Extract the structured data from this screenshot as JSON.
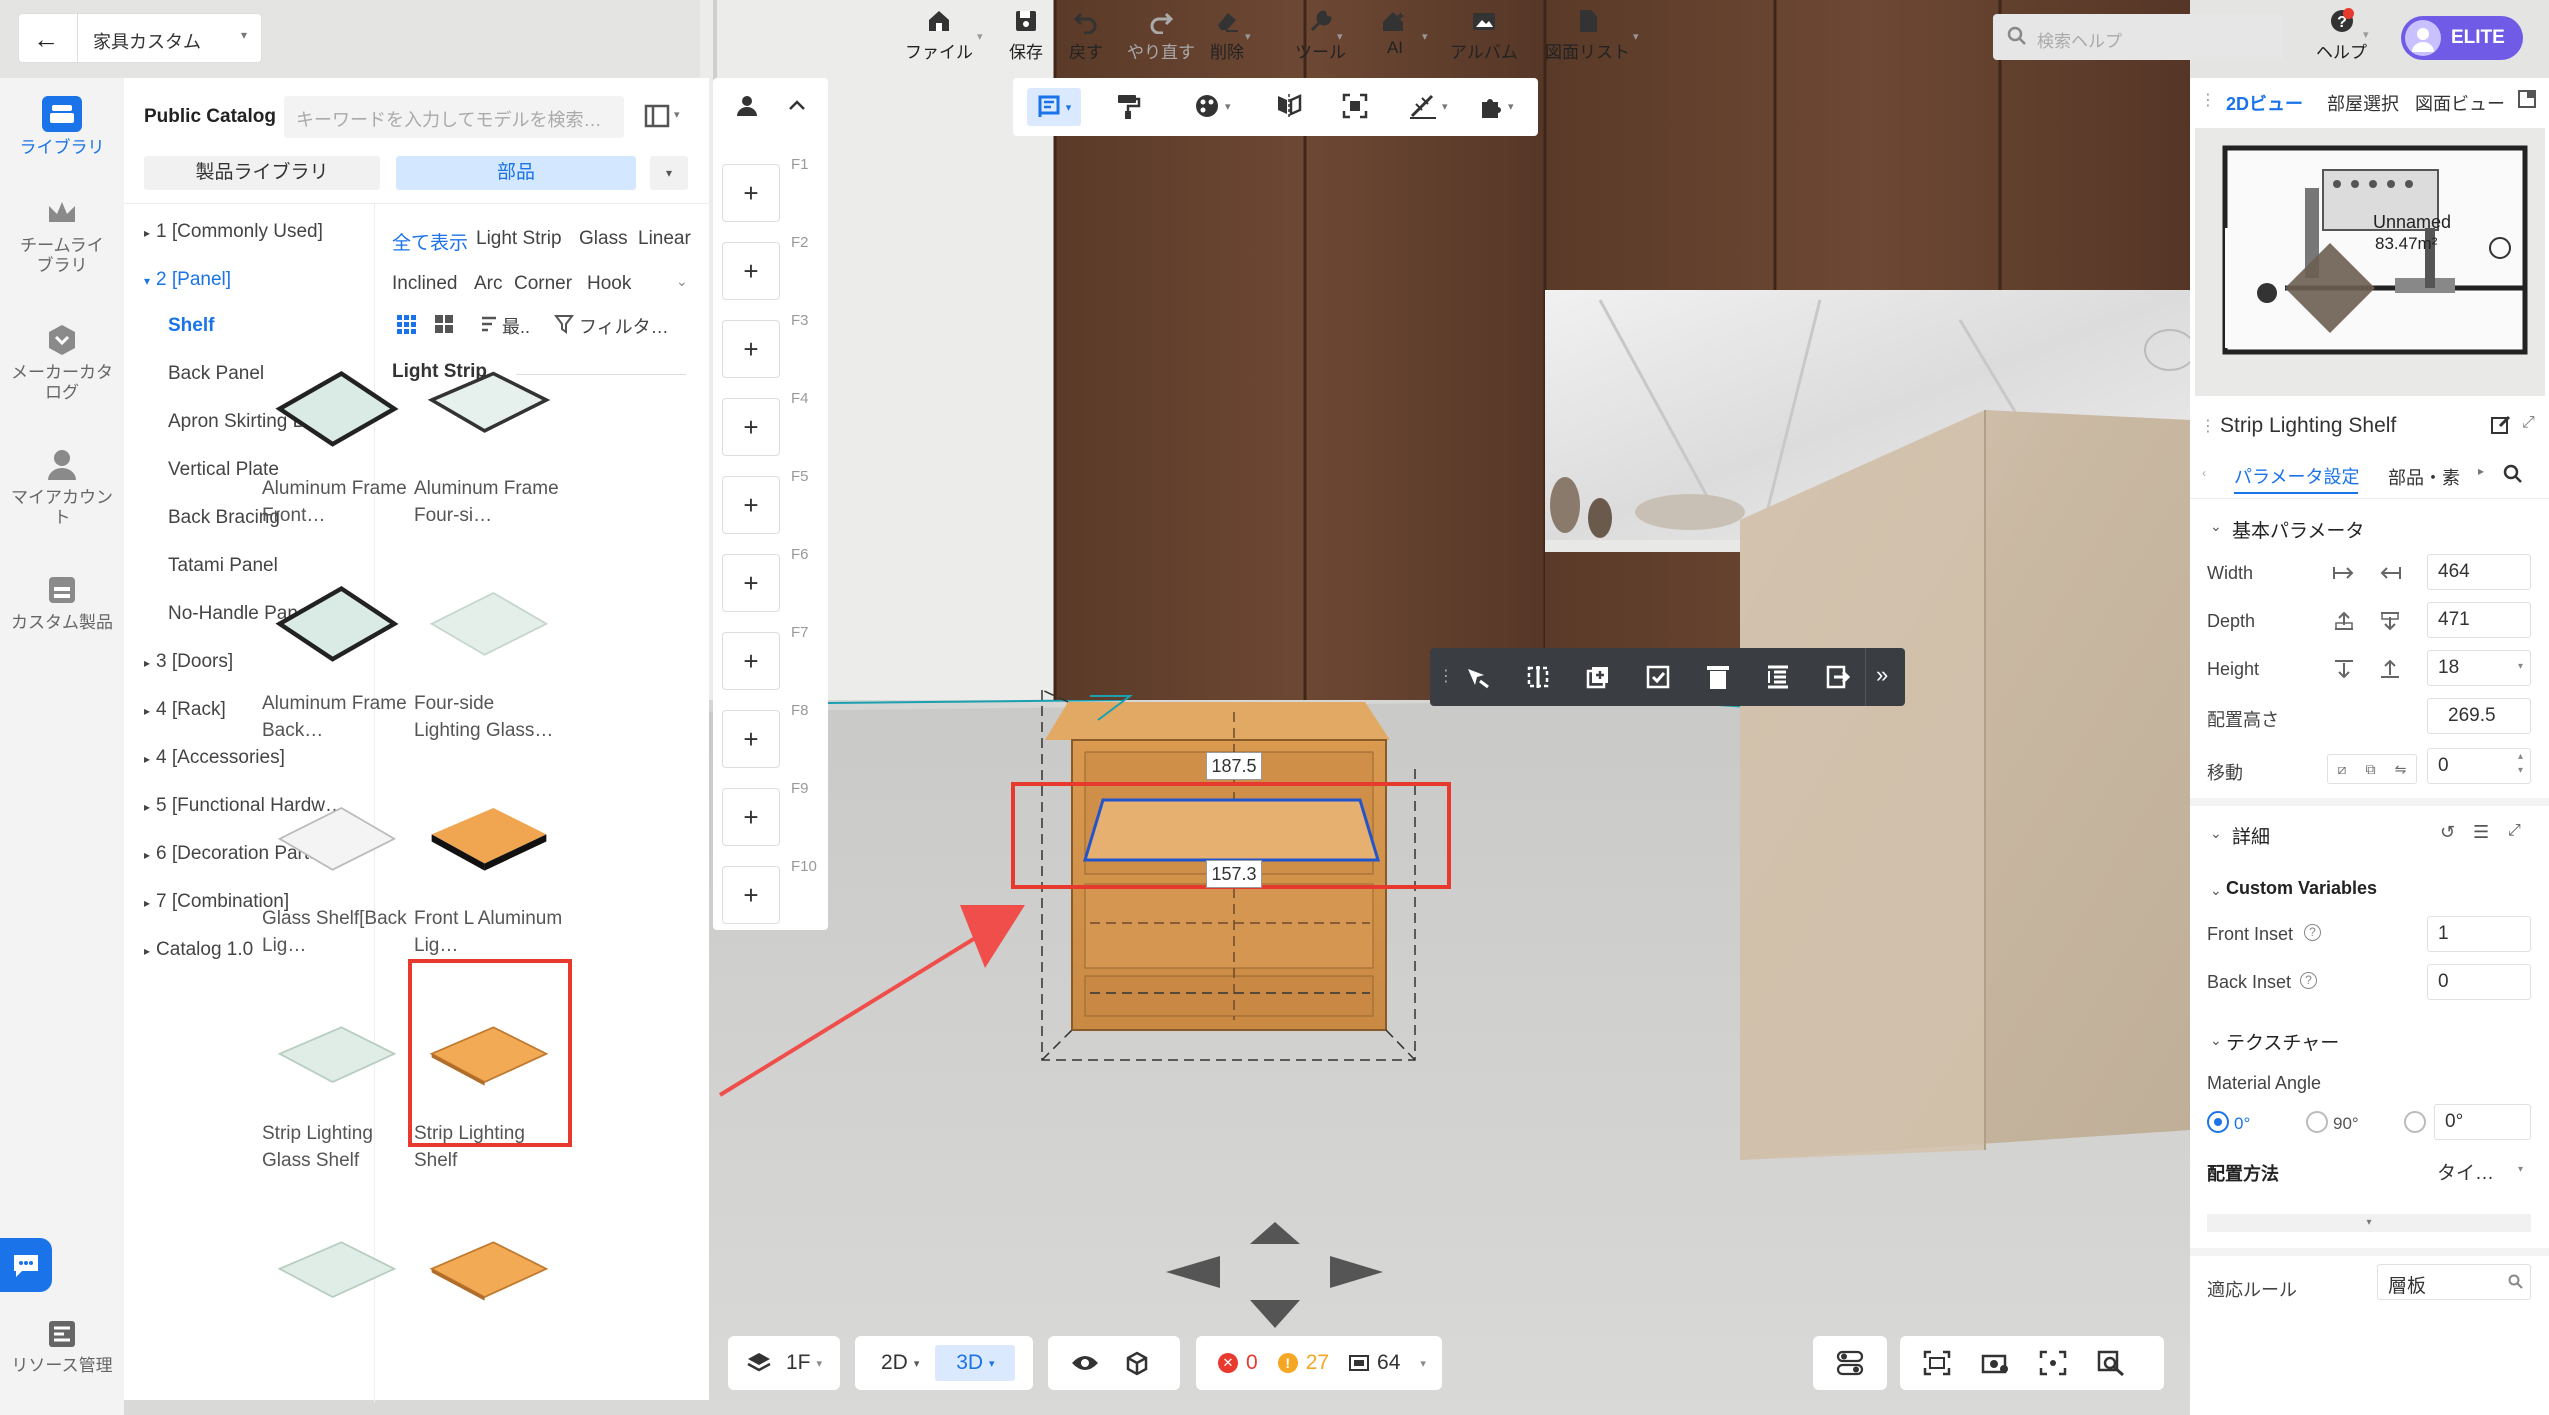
{
  "topbar": {
    "back_label": "←",
    "project_name": "家具カスタム",
    "file": "ファイル",
    "save": "保存",
    "undo": "戻す",
    "redo": "やり直す",
    "delete": "削除",
    "tools": "ツール",
    "ai": "AI",
    "album": "アルバム",
    "drawing_list": "図面リスト",
    "search_placeholder": "検索ヘルプ",
    "help": "ヘルプ",
    "plan_badge": "ELITE"
  },
  "rail": {
    "items": [
      {
        "label": "ライブラリ",
        "icon": "library-icon",
        "active": true
      },
      {
        "label": "チームライブラリ",
        "icon": "crown-icon"
      },
      {
        "label": "メーカーカタログ",
        "icon": "maker-icon"
      },
      {
        "label": "マイアカウント",
        "icon": "user-icon"
      },
      {
        "label": "カスタム製品",
        "icon": "custom-product-icon"
      }
    ],
    "resource": "リソース管理"
  },
  "catalog": {
    "title": "Public Catalog",
    "search_placeholder": "キーワードを入力してモデルを検索…",
    "tab_product_library": "製品ライブラリ",
    "tab_parts": "部品",
    "tree": [
      {
        "label": "1 [Commonly Used]",
        "arrow": "▸"
      },
      {
        "label": "2 [Panel]",
        "arrow": "▾",
        "open": true
      },
      {
        "label": "Shelf",
        "sub": true,
        "active": true
      },
      {
        "label": "Back Panel",
        "sub": true
      },
      {
        "label": "Apron Skirting Board",
        "sub": true
      },
      {
        "label": "Vertical Plate",
        "sub": true
      },
      {
        "label": "Back Bracing",
        "sub": true
      },
      {
        "label": "Tatami Panel",
        "sub": true
      },
      {
        "label": "No-Handle Panel",
        "sub": true
      },
      {
        "label": "3 [Doors]",
        "arrow": "▸"
      },
      {
        "label": "4 [Rack]",
        "arrow": "▸"
      },
      {
        "label": "4 [Accessories]",
        "arrow": "▸"
      },
      {
        "label": "5 [Functional Hardw…",
        "arrow": "▸"
      },
      {
        "label": "6 [Decoration Parts]",
        "arrow": "▸"
      },
      {
        "label": "7 [Combination]",
        "arrow": "▸"
      },
      {
        "label": "Catalog 1.0",
        "arrow": "▸"
      }
    ],
    "filters_row1": [
      "全て表示",
      "Light Strip",
      "Glass",
      "Linear"
    ],
    "filters_row2": [
      "Inclined",
      "Arc",
      "Corner",
      "Hook"
    ],
    "sort_label": "最..",
    "filter_label": "フィルタ…",
    "section_title": "Light Strip",
    "products": [
      {
        "name": "Aluminum Frame Front…",
        "kind": "glass-dark"
      },
      {
        "name": "Aluminum Frame Four-si…",
        "kind": "glass-dark2"
      },
      {
        "name": "Aluminum Frame Back…",
        "kind": "glass-dark"
      },
      {
        "name": "Four-side Lighting Glass…",
        "kind": "glass-light"
      },
      {
        "name": "Glass Shelf[Back Lig…",
        "kind": "glass-clear"
      },
      {
        "name": "Front L Aluminum Lig…",
        "kind": "wood-dark"
      },
      {
        "name": "Strip Lighting Glass Shelf",
        "kind": "glass-green"
      },
      {
        "name": "Strip Lighting Shelf",
        "kind": "wood",
        "selected": true
      },
      {
        "name": "",
        "kind": "glass-green"
      },
      {
        "name": "",
        "kind": "wood"
      }
    ]
  },
  "fkeys": [
    "F1",
    "F2",
    "F3",
    "F4",
    "F5",
    "F6",
    "F7",
    "F8",
    "F9",
    "F10"
  ],
  "viewport": {
    "dim_top": "187.5",
    "dim_bottom": "157.3"
  },
  "minimap": {
    "tab_2d": "2Dビュー",
    "tab_room": "部屋選択",
    "tab_drawing": "図面ビュー",
    "room_name": "Unnamed",
    "room_area": "83.47m²"
  },
  "props": {
    "title": "Strip Lighting Shelf",
    "tab_params": "パラメータ設定",
    "tab_parts": "部品・素",
    "sec_basic": "基本パラメータ",
    "width_label": "Width",
    "width": "464",
    "depth_label": "Depth",
    "depth": "471",
    "height_label": "Height",
    "height": "18",
    "elev_label": "配置高さ",
    "elev": "269.5",
    "move_label": "移動",
    "move": "0",
    "sec_detail": "詳細",
    "sec_custom": "Custom Variables",
    "front_inset_label": "Front Inset",
    "front_inset": "1",
    "back_inset_label": "Back Inset",
    "back_inset": "0",
    "sec_texture": "テクスチャー",
    "material_angle": "Material Angle",
    "angle_0": "0°",
    "angle_90": "90°",
    "angle_custom": "0°",
    "placement_label": "配置方法",
    "placement": "タイ…",
    "rule_label": "適応ルール",
    "rule": "層板"
  },
  "bottom": {
    "floor": "1F",
    "view2d": "2D",
    "view3d": "3D",
    "errors": "0",
    "warnings": "27",
    "objects": "64"
  },
  "colors": {
    "accent": "#1a73e8",
    "highlight": "#e8392f",
    "elite": "#6f5be6"
  }
}
